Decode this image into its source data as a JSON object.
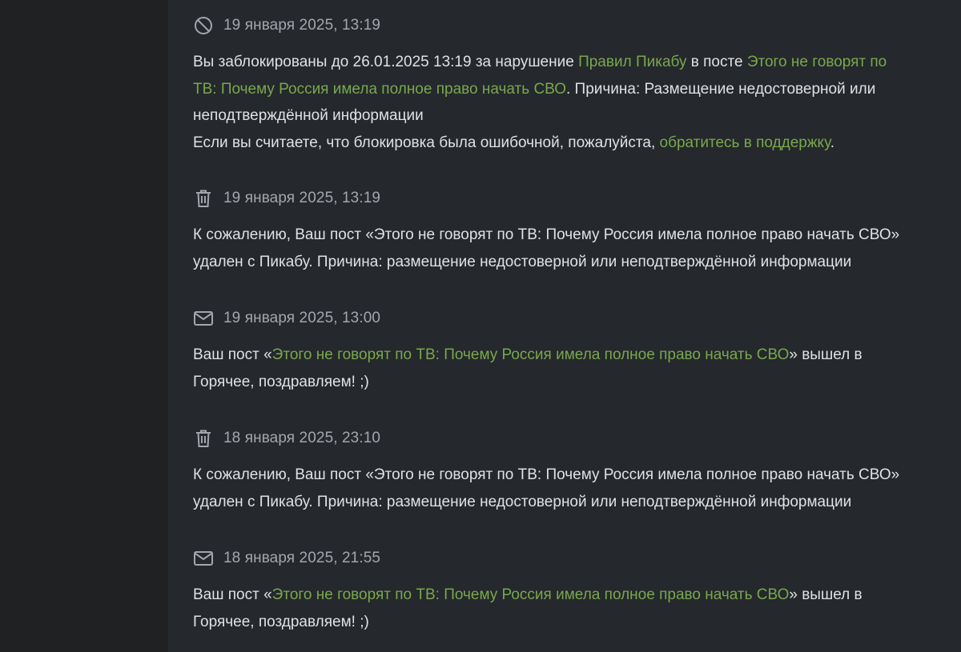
{
  "colors": {
    "background": "#1f2123",
    "panel": "#25282c",
    "text": "#dfe1e4",
    "muted": "#a3a7ad",
    "link": "#78a84e"
  },
  "notifications": [
    {
      "icon": "block-icon",
      "date": "19 января 2025, 13:19",
      "lines": [
        [
          {
            "text": "Вы заблокированы до 26.01.2025 13:19 за нарушение ",
            "link": false
          },
          {
            "text": "Правил Пикабу",
            "link": true
          },
          {
            "text": " в посте ",
            "link": false
          },
          {
            "text": "Этого не говорят по",
            "link": true
          }
        ],
        [
          {
            "text": "ТВ: Почему Россия имела полное право начать СВО",
            "link": true
          },
          {
            "text": ". Причина: Размещение недостоверной или",
            "link": false
          }
        ],
        [
          {
            "text": "неподтверждённой информации",
            "link": false
          }
        ],
        [
          {
            "text": "Если вы считаете, что блокировка была ошибочной, пожалуйста, ",
            "link": false
          },
          {
            "text": "обратитесь в поддержку",
            "link": true
          },
          {
            "text": ".",
            "link": false
          }
        ]
      ]
    },
    {
      "icon": "trash-icon",
      "date": "19 января 2025, 13:19",
      "lines": [
        [
          {
            "text": "К сожалению, Ваш пост «Этого не говорят по ТВ: Почему Россия имела полное право начать СВО»",
            "link": false
          }
        ],
        [
          {
            "text": "удален с Пикабу. Причина: размещение недостоверной или неподтверждённой информации",
            "link": false
          }
        ]
      ]
    },
    {
      "icon": "mail-icon",
      "date": "19 января 2025, 13:00",
      "lines": [
        [
          {
            "text": "Ваш пост «",
            "link": false
          },
          {
            "text": "Этого не говорят по ТВ: Почему Россия имела полное право начать СВО",
            "link": true
          },
          {
            "text": "» вышел в",
            "link": false
          }
        ],
        [
          {
            "text": "Горячее, поздравляем! ;)",
            "link": false
          }
        ]
      ]
    },
    {
      "icon": "trash-icon",
      "date": "18 января 2025, 23:10",
      "lines": [
        [
          {
            "text": "К сожалению, Ваш пост «Этого не говорят по ТВ: Почему Россия имела полное право начать СВО»",
            "link": false
          }
        ],
        [
          {
            "text": "удален с Пикабу. Причина: размещение недостоверной или неподтверждённой информации",
            "link": false
          }
        ]
      ]
    },
    {
      "icon": "mail-icon",
      "date": "18 января 2025, 21:55",
      "lines": [
        [
          {
            "text": "Ваш пост «",
            "link": false
          },
          {
            "text": "Этого не говорят по ТВ: Почему Россия имела полное право начать СВО",
            "link": true
          },
          {
            "text": "» вышел в",
            "link": false
          }
        ],
        [
          {
            "text": "Горячее, поздравляем! ;)",
            "link": false
          }
        ]
      ]
    }
  ]
}
